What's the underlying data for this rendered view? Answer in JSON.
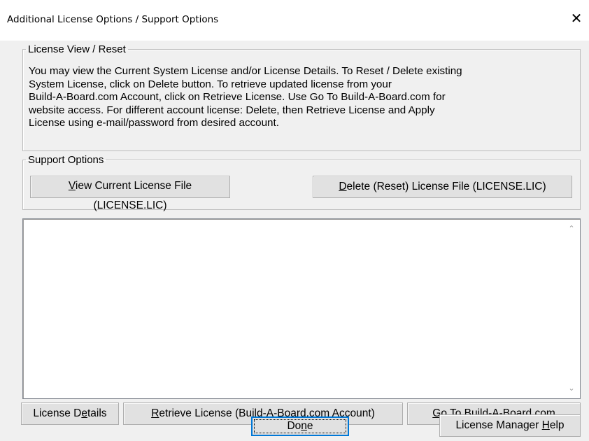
{
  "window": {
    "title": "Additional License Options / Support Options",
    "close_glyph": "✕"
  },
  "license_group": {
    "legend": "License View / Reset",
    "description_lines": [
      "You may view the Current System License and/or License Details.  To Reset / Delete existing",
      "System License, click on Delete button.  To retrieve updated license from your",
      "Build-A-Board.com Account, click on Retrieve License.  Use Go To Build-A-Board.com for",
      "website access.  For different account license: Delete, then Retrieve License and Apply",
      "License using e-mail/password from desired account."
    ]
  },
  "support_group": {
    "legend": "Support Options",
    "view_button": {
      "mnemonic": "V",
      "rest": "iew Current License File (LICENSE.LIC)"
    },
    "delete_button": {
      "mnemonic": "D",
      "rest": "elete (Reset) License File (LICENSE.LIC)"
    }
  },
  "output_box": {
    "value": "",
    "scroll_up_glyph": "⌃",
    "scroll_down_glyph": "⌄"
  },
  "bottom_buttons": {
    "details": {
      "pre": "License D",
      "mnemonic": "e",
      "post": "tails"
    },
    "retrieve": {
      "mnemonic": "R",
      "rest": "etrieve License (Build-A-Board.com Account)"
    },
    "goto": {
      "mnemonic": "G",
      "rest": "o To Build-A-Board.com"
    },
    "done": {
      "pre": "Do",
      "mnemonic": "n",
      "post": "e"
    },
    "help": {
      "pre": "License Manager ",
      "mnemonic": "H",
      "post": "elp"
    }
  },
  "colors": {
    "dialog_bg": "#f0f0f0",
    "button_face": "#e1e1e1",
    "default_button_border": "#0078d7"
  },
  "icons": {
    "close": "close-icon",
    "scroll_up": "chevron-up-icon",
    "scroll_down": "chevron-down-icon"
  }
}
